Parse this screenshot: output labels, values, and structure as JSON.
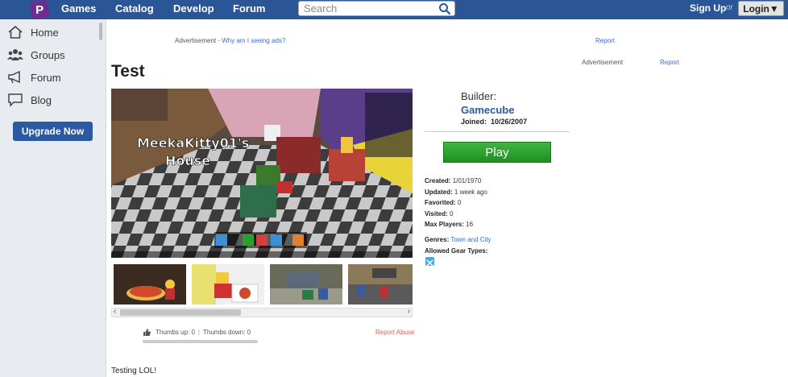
{
  "nav": {
    "logo_letter": "P",
    "links": [
      "Games",
      "Catalog",
      "Develop",
      "Forum"
    ],
    "search_placeholder": "Search",
    "signup": "Sign Up",
    "or": "or",
    "login": "Login▼"
  },
  "sidebar": {
    "items": [
      {
        "label": "Home",
        "icon": "home-icon"
      },
      {
        "label": "Groups",
        "icon": "groups-icon"
      },
      {
        "label": "Forum",
        "icon": "megaphone-icon"
      },
      {
        "label": "Blog",
        "icon": "speech-bubble-icon"
      }
    ],
    "upgrade": "Upgrade Now"
  },
  "ads": {
    "top_prefix": "Advertisement - ",
    "top_link": "Why am I seeing ads?",
    "top_report": "Report",
    "side_label": "Advertisement",
    "side_report": "Report"
  },
  "game": {
    "title": "Test",
    "screenshot_caption_1": "MeekaKitty01's",
    "screenshot_caption_2": "House",
    "thumbs_up": "Thumbs up: 0",
    "thumbs_down": "Thumbs down: 0",
    "report_abuse": "Report Abuse",
    "description": "Testing LOL!"
  },
  "builder": {
    "label": "Builder:",
    "name": "Gamecube",
    "joined_label": "Joined:",
    "joined_date": "10/26/2007"
  },
  "play": "Play",
  "stats": {
    "created_label": "Created:",
    "created": "1/01/1970",
    "updated_label": "Updated:",
    "updated": "1 week ago",
    "favorited_label": "Favorited:",
    "favorited": "0",
    "visited_label": "Visited:",
    "visited": "0",
    "max_label": "Max Players:",
    "max": "16",
    "genres_label": "Genres:",
    "genres": "Town and City",
    "gear_label": "Allowed Gear Types:"
  },
  "colors": {
    "nav_bg": "#2a5596",
    "sidebar_bg": "#e8ebef",
    "upgrade_bg": "#2b5aa3",
    "play_green": "#2aa22a",
    "link_blue": "#3b6ccf"
  }
}
